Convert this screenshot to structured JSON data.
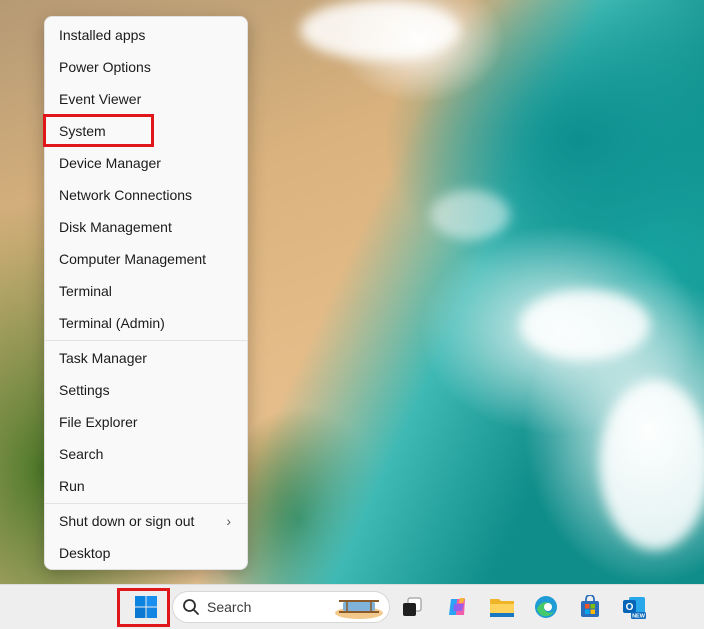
{
  "context_menu": {
    "group1": [
      "Installed apps",
      "Power Options",
      "Event Viewer",
      "System",
      "Device Manager",
      "Network Connections",
      "Disk Management",
      "Computer Management",
      "Terminal",
      "Terminal (Admin)"
    ],
    "group2": [
      "Task Manager",
      "Settings",
      "File Explorer",
      "Search",
      "Run"
    ],
    "group3": [
      "Shut down or sign out",
      "Desktop"
    ],
    "submenu_arrow": "›",
    "highlighted_item": "System"
  },
  "taskbar": {
    "search_placeholder": "Search",
    "icons": [
      "windows-start-icon",
      "search-icon",
      "task-view-icon",
      "copilot-icon",
      "file-explorer-icon",
      "edge-icon",
      "store-icon",
      "outlook-icon"
    ],
    "outlook_badge": "NEW"
  },
  "colors": {
    "highlight": "#e0161b",
    "windows_blue": "#0078d4"
  }
}
